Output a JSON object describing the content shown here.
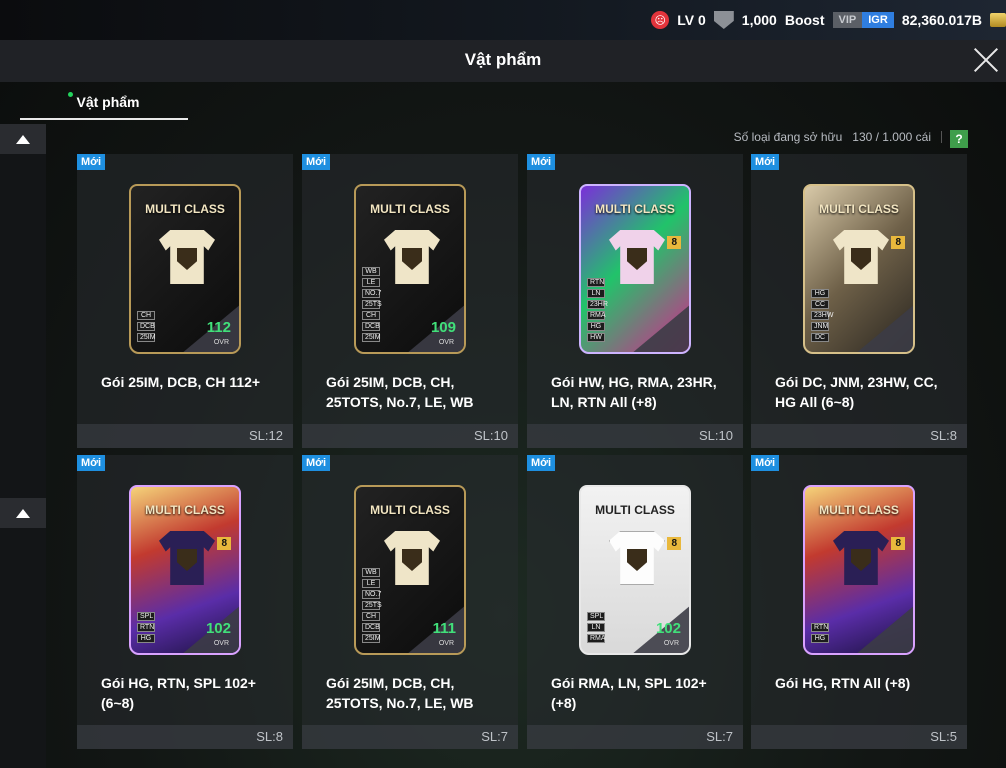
{
  "topbar": {
    "level": "LV 0",
    "shield_value": "1,000",
    "boost_label": "Boost",
    "vip_label": "VIP",
    "igr_label": "IGR",
    "currency": "82,360.017B"
  },
  "header": {
    "title": "Vật phẩm"
  },
  "tab": {
    "label": "Vật phẩm"
  },
  "owned": {
    "label": "Số loại đang sở hữu",
    "value": "130 / 1.000 cái",
    "help": "?"
  },
  "items": [
    {
      "badge": "Mới",
      "pack_label": "MULTI CLASS",
      "title": "Gói 25IM, DCB, CH 112+",
      "qty": "SL:12",
      "tags": [
        "CH",
        "DCB",
        "25IM"
      ],
      "ovr": "112",
      "ovr_sub": "OVR"
    },
    {
      "badge": "Mới",
      "pack_label": "MULTI CLASS",
      "title": "Gói 25IM, DCB, CH, 25TOTS, No.7, LE, WB",
      "qty": "SL:10",
      "tags": [
        "WB",
        "LE",
        "NO.7",
        "25TS",
        "CH",
        "DCB",
        "25IM"
      ],
      "ovr": "109",
      "ovr_sub": "OVR"
    },
    {
      "badge": "Mới",
      "pack_label": "MULTI CLASS",
      "title": "Gói HW, HG, RMA, 23HR, LN, RTN All (+8)",
      "qty": "SL:10",
      "tags": [
        "RTN",
        "LN",
        "23HR",
        "RMA",
        "HG",
        "HW"
      ],
      "eight": "8"
    },
    {
      "badge": "Mới",
      "pack_label": "MULTI CLASS",
      "title": "Gói DC, JNM, 23HW, CC, HG All (6~8)",
      "qty": "SL:8",
      "tags": [
        "HG",
        "CC",
        "23HW",
        "JNM",
        "DC"
      ],
      "eight": "8"
    },
    {
      "badge": "Mới",
      "pack_label": "MULTI CLASS",
      "title": "Gói HG, RTN, SPL 102+ (6~8)",
      "qty": "SL:8",
      "tags": [
        "SPL",
        "RTN",
        "HG"
      ],
      "ovr": "102",
      "ovr_sub": "OVR",
      "eight": "8"
    },
    {
      "badge": "Mới",
      "pack_label": "MULTI CLASS",
      "title": "Gói 25IM, DCB, CH, 25TOTS, No.7, LE, WB",
      "qty": "SL:7",
      "tags": [
        "WB",
        "LE",
        "NO.7",
        "25TS",
        "CH",
        "DCB",
        "25IM"
      ],
      "ovr": "111",
      "ovr_sub": "OVR"
    },
    {
      "badge": "Mới",
      "pack_label": "MULTI CLASS",
      "title": "Gói RMA, LN, SPL 102+ (+8)",
      "qty": "SL:7",
      "tags": [
        "SPL",
        "LN",
        "RMA"
      ],
      "ovr": "102",
      "ovr_sub": "OVR",
      "eight": "8"
    },
    {
      "badge": "Mới",
      "pack_label": "MULTI CLASS",
      "title": "Gói HG, RTN All (+8)",
      "qty": "SL:5",
      "tags": [
        "RTN",
        "HG"
      ],
      "eight": "8"
    }
  ]
}
